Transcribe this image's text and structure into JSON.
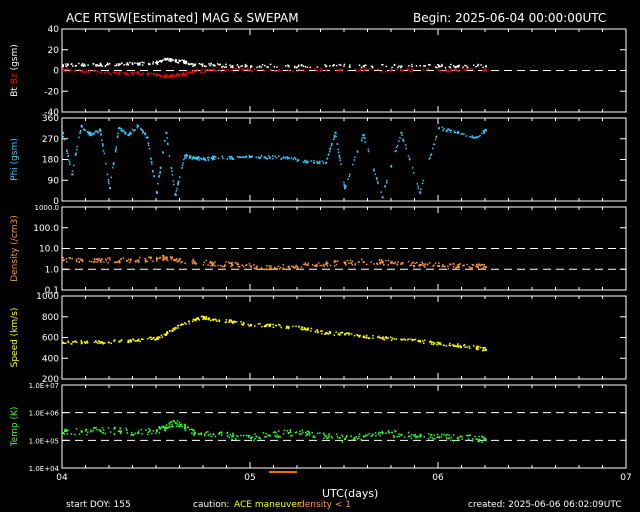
{
  "header": {
    "title": "ACE RTSW[Estimated] MAG & SWEPAM",
    "begin": "Begin: 2025-06-04 00:00:00UTC"
  },
  "footer": {
    "start_doy": "start DOY: 155",
    "caution_label": "caution:",
    "caution_maneuver": "ACE maneuver",
    "caution_density": "density < 1",
    "created": "created: 2025-06-06 06:02:09UTC"
  },
  "chart_data": [
    {
      "type": "scatter",
      "panel": "mag",
      "ylabel_parts": [
        "Bt",
        "Bz",
        "(gsm)"
      ],
      "ylim": [
        -40,
        40
      ],
      "yticks": [
        40,
        20,
        0,
        -20,
        -40
      ],
      "ref_lines": [
        0
      ],
      "colors": {
        "Bt": "#ffffff",
        "Bz": "#ff0000"
      },
      "series": [
        {
          "name": "Bt",
          "x": [
            4.0,
            4.1,
            4.2,
            4.3,
            4.4,
            4.5,
            4.55,
            4.6,
            4.65,
            4.7,
            4.8,
            4.9,
            5.0,
            5.2,
            5.4,
            5.6,
            5.8,
            6.0,
            6.1,
            6.25
          ],
          "y": [
            6,
            6,
            6,
            7,
            7,
            8,
            12,
            10,
            9,
            6,
            6,
            5,
            5,
            5,
            5,
            5,
            5,
            5,
            5,
            5
          ]
        },
        {
          "name": "Bz",
          "x": [
            4.0,
            4.1,
            4.2,
            4.3,
            4.4,
            4.5,
            4.55,
            4.6,
            4.65,
            4.7,
            4.8,
            4.9,
            5.0,
            5.2,
            5.4,
            5.6,
            5.8,
            6.0,
            6.1,
            6.25
          ],
          "y": [
            1,
            0,
            -1,
            -2,
            -2,
            -3,
            -5,
            -4,
            -3,
            0,
            1,
            1,
            1,
            1,
            1,
            1,
            1,
            1,
            1,
            1
          ]
        }
      ]
    },
    {
      "type": "scatter",
      "panel": "phi",
      "ylabel": "Phi (gsm)",
      "ylim": [
        0,
        360
      ],
      "yticks": [
        360,
        270,
        180,
        90,
        0
      ],
      "color": "#33ccff",
      "series": [
        {
          "name": "Phi",
          "x": [
            4.0,
            4.05,
            4.1,
            4.15,
            4.2,
            4.25,
            4.3,
            4.35,
            4.4,
            4.45,
            4.5,
            4.55,
            4.6,
            4.65,
            4.7,
            4.75,
            4.8,
            4.9,
            5.0,
            5.1,
            5.2,
            5.3,
            5.4,
            5.45,
            5.5,
            5.6,
            5.7,
            5.8,
            5.9,
            6.0,
            6.1,
            6.2,
            6.25
          ],
          "y": [
            300,
            120,
            330,
            290,
            310,
            60,
            320,
            290,
            330,
            280,
            40,
            300,
            30,
            200,
            190,
            185,
            190,
            190,
            195,
            192,
            190,
            175,
            170,
            300,
            60,
            290,
            20,
            300,
            40,
            320,
            300,
            280,
            310
          ]
        }
      ]
    },
    {
      "type": "scatter",
      "panel": "density",
      "ylabel": "Density (/cm3)",
      "yscale": "log",
      "ylim": [
        0.1,
        1000
      ],
      "yticks": [
        "1000.0",
        "100.0",
        "10.0",
        "1.0",
        "0.1"
      ],
      "ref_lines": [
        10,
        1
      ],
      "color": "#ff9933",
      "series": [
        {
          "name": "Density",
          "x": [
            4.0,
            4.1,
            4.2,
            4.3,
            4.4,
            4.5,
            4.55,
            4.6,
            4.7,
            4.8,
            4.9,
            5.0,
            5.1,
            5.2,
            5.3,
            5.4,
            5.5,
            5.6,
            5.7,
            5.8,
            5.9,
            6.0,
            6.1,
            6.2,
            6.25
          ],
          "y": [
            3,
            3.2,
            3,
            2.8,
            3,
            3.5,
            4,
            3,
            2.5,
            2,
            1.8,
            1.5,
            1.2,
            1.5,
            1.8,
            2,
            2.2,
            2.5,
            2.3,
            2,
            1.8,
            1.6,
            1.5,
            1.5,
            1.4
          ]
        }
      ]
    },
    {
      "type": "scatter",
      "panel": "speed",
      "ylabel": "Speed (km/s)",
      "ylim": [
        200,
        1000
      ],
      "yticks": [
        1000,
        800,
        600,
        400,
        200
      ],
      "color": "#ffff00",
      "series": [
        {
          "name": "Speed",
          "x": [
            4.0,
            4.1,
            4.2,
            4.3,
            4.4,
            4.5,
            4.55,
            4.6,
            4.7,
            4.75,
            4.8,
            4.9,
            5.0,
            5.1,
            5.2,
            5.3,
            5.4,
            5.5,
            5.6,
            5.7,
            5.8,
            5.9,
            6.0,
            6.1,
            6.2,
            6.25
          ],
          "y": [
            560,
            560,
            560,
            570,
            580,
            600,
            640,
            700,
            780,
            800,
            780,
            760,
            730,
            720,
            710,
            690,
            650,
            640,
            620,
            600,
            590,
            570,
            550,
            530,
            510,
            490
          ]
        }
      ]
    },
    {
      "type": "scatter",
      "panel": "temp",
      "ylabel": "Temp (K)",
      "yscale": "log",
      "ylim": [
        10000,
        10000000
      ],
      "yticks": [
        "1.0E+07",
        "1.0E+06",
        "1.0E+05",
        "1.0E+04"
      ],
      "ref_lines": [
        1000000,
        100000
      ],
      "color": "#33ff33",
      "series": [
        {
          "name": "Temp",
          "x": [
            4.0,
            4.1,
            4.2,
            4.3,
            4.4,
            4.5,
            4.55,
            4.6,
            4.65,
            4.7,
            4.8,
            4.9,
            5.0,
            5.1,
            5.2,
            5.3,
            5.4,
            5.5,
            5.6,
            5.7,
            5.8,
            5.9,
            6.0,
            6.1,
            6.2,
            6.25
          ],
          "y": [
            200000,
            220000,
            240000,
            230000,
            200000,
            250000,
            300000,
            450000,
            300000,
            200000,
            180000,
            150000,
            130000,
            160000,
            200000,
            180000,
            150000,
            120000,
            150000,
            200000,
            170000,
            150000,
            140000,
            130000,
            120000,
            110000
          ]
        }
      ]
    }
  ],
  "x_axis": {
    "label": "UTC(days)",
    "range": [
      4,
      7
    ],
    "tick_labels": [
      "04",
      "05",
      "06",
      "07"
    ]
  }
}
